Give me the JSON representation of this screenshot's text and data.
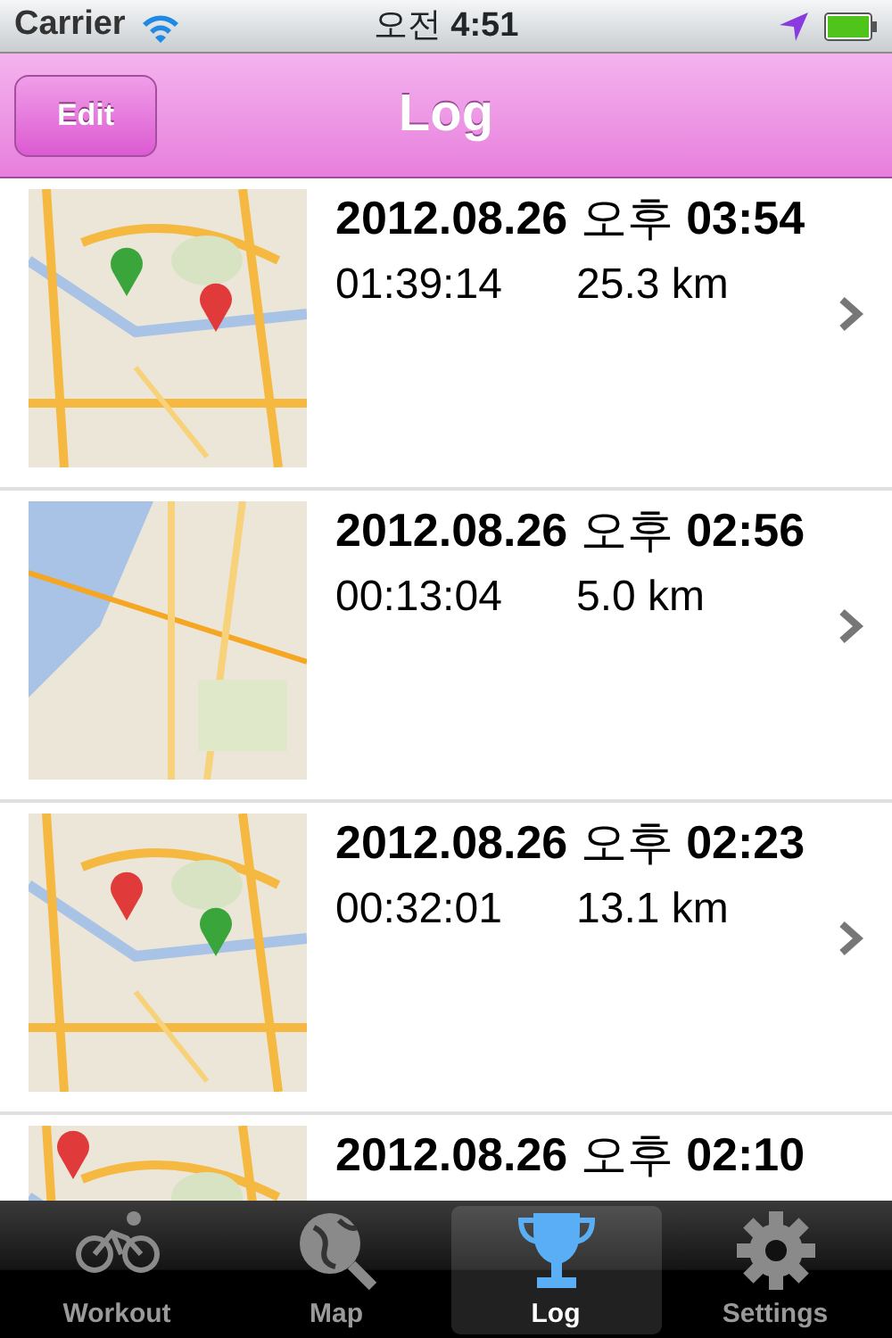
{
  "status_bar": {
    "carrier": "Carrier",
    "time": "오전 **4:51**"
  },
  "nav_bar": {
    "title": "Log",
    "edit_button": "Edit"
  },
  "log_entries": [
    {
      "title": "**2012.08.26** 오후 **03:54**",
      "duration": "01:39:14",
      "distance": "25.3 km"
    },
    {
      "title": "**2012.08.26** 오후 **02:56**",
      "duration": "00:13:04",
      "distance": "5.0 km"
    },
    {
      "title": "**2012.08.26** 오후 **02:23**",
      "duration": "00:32:01",
      "distance": "13.1 km"
    },
    {
      "title": "**2012.08.26** 오후 **02:10**"
    }
  ],
  "tab_bar": [
    {
      "label": "Workout",
      "kind": "bike",
      "selected": false
    },
    {
      "label": "Map",
      "kind": "globe",
      "selected": false
    },
    {
      "label": "Log",
      "kind": "trophy",
      "selected": true
    },
    {
      "label": "Settings",
      "kind": "gear",
      "selected": false
    }
  ]
}
